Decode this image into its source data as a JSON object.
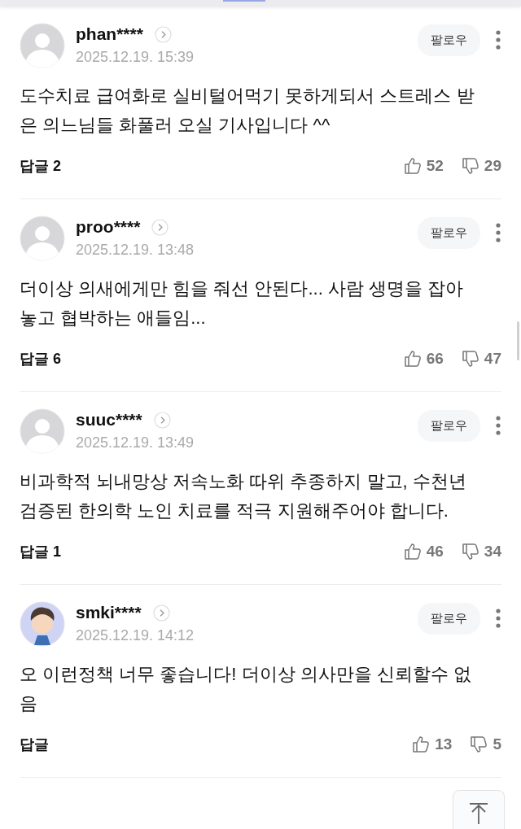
{
  "comments": [
    {
      "kind": "default",
      "user": "phan****",
      "date": "2025.12.19. 15:39",
      "follow": "팔로우",
      "text": "도수치료 급여화로 실비털어먹기 못하게되서 스트레스 받은 의느님들 화풀러 오실 기사입니다 ^^",
      "replies": "답글 2",
      "likes": "52",
      "dislikes": "29"
    },
    {
      "kind": "default",
      "user": "proo****",
      "date": "2025.12.19. 13:48",
      "follow": "팔로우",
      "text": "더이상 의새에게만 힘을 줘선 안된다... 사람 생명을 잡아놓고 협박하는 애들임...",
      "replies": "답글 6",
      "likes": "66",
      "dislikes": "47"
    },
    {
      "kind": "default",
      "user": "suuc****",
      "date": "2025.12.19. 13:49",
      "follow": "팔로우",
      "text": "비과학적 뇌내망상 저속노화 따위 추종하지 말고, 수천년 검증된 한의학 노인 치료를 적극 지원해주어야 합니다.",
      "replies": "답글 1",
      "likes": "46",
      "dislikes": "34"
    },
    {
      "kind": "cartoon",
      "user": "smki****",
      "date": "2025.12.19. 14:12",
      "follow": "팔로우",
      "text": "오 이런정책 너무 좋습니다! 더이상 의사만을 신뢰할수 없음",
      "replies": "답글",
      "likes": "13",
      "dislikes": "5"
    }
  ]
}
